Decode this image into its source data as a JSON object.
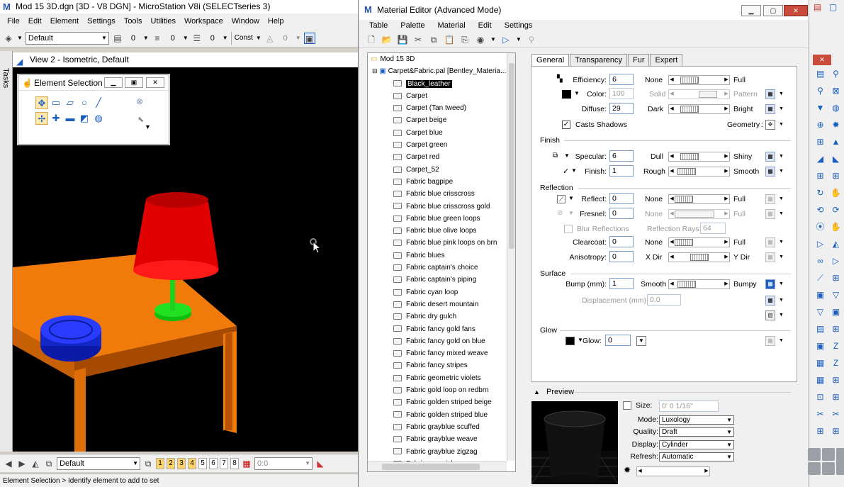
{
  "microstation": {
    "title": "Mod 15 3D.dgn [3D - V8 DGN] - MicroStation V8i (SELECTseries 3)",
    "menu": [
      "File",
      "Edit",
      "Element",
      "Settings",
      "Tools",
      "Utilities",
      "Workspace",
      "Window",
      "Help"
    ],
    "toolbar": {
      "level": "Default",
      "n1": "0",
      "n2": "0",
      "n3": "0",
      "constr": "Const",
      "n4": "0"
    },
    "tasks_label": "Tasks",
    "view_title": "View 2 - Isometric, Default",
    "element_selection": {
      "title": "Element Selection"
    },
    "bottom": {
      "level": "Default",
      "views": [
        "1",
        "2",
        "3",
        "4",
        "5",
        "6",
        "7",
        "8"
      ],
      "coord": "0:0"
    },
    "status": "Element Selection > Identify element to add to set"
  },
  "material_editor": {
    "title": "Material Editor (Advanced Mode)",
    "menu": [
      "Table",
      "Palette",
      "Material",
      "Edit",
      "Settings"
    ],
    "tree": {
      "root": "Mod 15 3D",
      "palette": "Carpet&Fabric.pal [Bentley_Materia...",
      "items": [
        "Black_leather",
        "Carpet",
        "Carpet (Tan tweed)",
        "Carpet beige",
        "Carpet blue",
        "Carpet green",
        "Carpet red",
        "Carpet_52",
        "Fabric bagpipe",
        "Fabric blue crisscross",
        "Fabric blue crisscross gold",
        "Fabric blue green loops",
        "Fabric blue olive loops",
        "Fabric blue pink loops on brn",
        "Fabric blues",
        "Fabric captain's choice",
        "Fabric captain's piping",
        "Fabric cyan loop",
        "Fabric desert mountain",
        "Fabric dry gulch",
        "Fabric fancy gold fans",
        "Fabric fancy gold on blue",
        "Fabric fancy mixed weave",
        "Fabric fancy stripes",
        "Fabric geometric violets",
        "Fabric gold loop on redbrn",
        "Fabric golden striped beige",
        "Fabric golden striped blue",
        "Fabric grayblue scuffed",
        "Fabric grayblue weave",
        "Fabric grayblue zigzag",
        "Fabric greenish gray"
      ]
    },
    "tabs": [
      "General",
      "Transparency",
      "Fur",
      "Expert"
    ],
    "general": {
      "efficiency": {
        "label": "Efficiency:",
        "value": "6",
        "left": "None",
        "right": "Full"
      },
      "color": {
        "label": "Color:",
        "value": "100",
        "left": "Solid",
        "right": "Pattern"
      },
      "diffuse": {
        "label": "Diffuse:",
        "value": "29",
        "left": "Dark",
        "right": "Bright"
      },
      "casts_shadows": "Casts Shadows",
      "geometry": "Geometry :",
      "finish_section": "Finish",
      "specular": {
        "label": "Specular:",
        "value": "6",
        "left": "Dull",
        "right": "Shiny"
      },
      "finish": {
        "label": "Finish:",
        "value": "1",
        "left": "Rough",
        "right": "Smooth"
      },
      "reflection_section": "Reflection",
      "reflect": {
        "label": "Reflect:",
        "value": "0",
        "left": "None",
        "right": "Full"
      },
      "fresnel": {
        "label": "Fresnel:",
        "value": "0",
        "left": "None",
        "right": "Full"
      },
      "blur_reflections": "Blur Reflections",
      "reflection_rays": {
        "label": "Reflection Rays:",
        "value": "64"
      },
      "clearcoat": {
        "label": "Clearcoat:",
        "value": "0",
        "left": "None",
        "right": "Full"
      },
      "anisotropy": {
        "label": "Anisotropy:",
        "value": "0",
        "left": "X Dir",
        "right": "Y Dir"
      },
      "surface_section": "Surface",
      "bump": {
        "label": "Bump (mm):",
        "value": "1",
        "left": "Smooth",
        "right": "Bumpy"
      },
      "displacement": {
        "label": "Displacement (mm):",
        "value": "0.0"
      },
      "glow_section": "Glow",
      "glow": {
        "label": "Glow:",
        "value": "0"
      }
    },
    "preview": {
      "label": "Preview",
      "size": {
        "label": "Size:",
        "value": "0' 0 1/16\""
      },
      "mode": {
        "label": "Mode:",
        "value": "Luxology"
      },
      "quality": {
        "label": "Quality:",
        "value": "Draft"
      },
      "display": {
        "label": "Display:",
        "value": "Cylinder"
      },
      "refresh": {
        "label": "Refresh:",
        "value": "Automatic"
      }
    }
  }
}
